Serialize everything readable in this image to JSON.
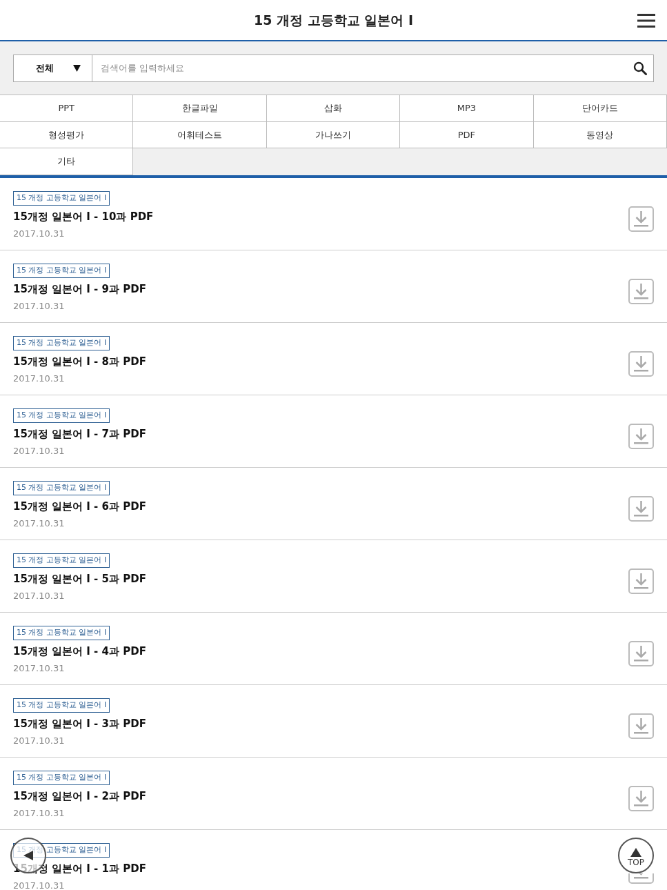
{
  "header": {
    "title": "15 개정 고등학교 일본어 I"
  },
  "search": {
    "category": "전체",
    "placeholder": "검색어를 입력하세요"
  },
  "categories": [
    {
      "label": "PPT",
      "selected": false
    },
    {
      "label": "한글파일",
      "selected": false
    },
    {
      "label": "삽화",
      "selected": false
    },
    {
      "label": "MP3",
      "selected": false
    },
    {
      "label": "단어카드",
      "selected": false
    },
    {
      "label": "형성평가",
      "selected": false
    },
    {
      "label": "어휘테스트",
      "selected": false
    },
    {
      "label": "가나쓰기",
      "selected": false
    },
    {
      "label": "PDF",
      "selected": false
    },
    {
      "label": "동영상",
      "selected": false
    },
    {
      "label": "기타",
      "selected": false
    }
  ],
  "items": [
    {
      "tag": "15 개정 고등학교 일본어 I",
      "title": "15개정 일본어 Ⅰ - 10과 PDF",
      "date": "2017.10.31"
    },
    {
      "tag": "15 개정 고등학교 일본어 I",
      "title": "15개정 일본어 Ⅰ - 9과 PDF",
      "date": "2017.10.31"
    },
    {
      "tag": "15 개정 고등학교 일본어 I",
      "title": "15개정 일본어 Ⅰ - 8과 PDF",
      "date": "2017.10.31"
    },
    {
      "tag": "15 개정 고등학교 일본어 I",
      "title": "15개정 일본어 Ⅰ - 7과 PDF",
      "date": "2017.10.31"
    },
    {
      "tag": "15 개정 고등학교 일본어 I",
      "title": "15개정 일본어 Ⅰ - 6과 PDF",
      "date": "2017.10.31"
    },
    {
      "tag": "15 개정 고등학교 일본어 I",
      "title": "15개정 일본어 Ⅰ - 5과 PDF",
      "date": "2017.10.31"
    },
    {
      "tag": "15 개정 고등학교 일본어 I",
      "title": "15개정 일본어 Ⅰ - 4과 PDF",
      "date": "2017.10.31"
    },
    {
      "tag": "15 개정 고등학교 일본어 I",
      "title": "15개정 일본어 Ⅰ - 3과 PDF",
      "date": "2017.10.31"
    },
    {
      "tag": "15 개정 고등학교 일본어 I",
      "title": "15개정 일본어 Ⅰ - 2과 PDF",
      "date": "2017.10.31"
    },
    {
      "tag": "15 개정 고등학교 일본어 I",
      "title": "15개정 일본어 Ⅰ - 1과 PDF",
      "date": "2017.10.31"
    }
  ],
  "top_button": {
    "label": "TOP"
  }
}
